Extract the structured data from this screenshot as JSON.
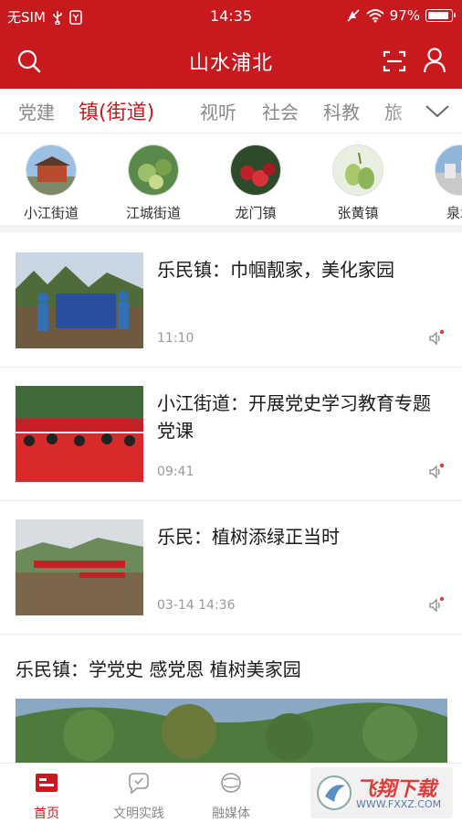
{
  "status_bar": {
    "carrier": "无SIM",
    "time": "14:35",
    "battery": "97%",
    "battery_level": 0.97
  },
  "header": {
    "title": "山水浦北"
  },
  "tabs": [
    {
      "label": "党建"
    },
    {
      "label": "镇(街道)"
    },
    {
      "label": "视听"
    },
    {
      "label": "社会"
    },
    {
      "label": "科教"
    },
    {
      "label": "旅"
    }
  ],
  "streets": [
    {
      "name": "小江街道"
    },
    {
      "name": "江城街道"
    },
    {
      "name": "龙门镇"
    },
    {
      "name": "张黄镇"
    },
    {
      "name": "泉水"
    }
  ],
  "news": [
    {
      "headline": "乐民镇：巾帼靓家，美化家园",
      "time": "11:10"
    },
    {
      "headline": "小江街道：开展党史学习教育专题党课",
      "time": "09:41"
    },
    {
      "headline": "乐民：植树添绿正当时",
      "time": "03-14 14:36"
    }
  ],
  "featured": {
    "headline": "乐民镇：学党史 感党恩 植树美家园"
  },
  "bottom_nav": [
    {
      "label": "首页",
      "icon": "home-icon"
    },
    {
      "label": "文明实践",
      "icon": "practice-icon"
    },
    {
      "label": "融媒体",
      "icon": "media-icon"
    }
  ],
  "watermark": {
    "text": "飞翔下载",
    "url": "WWW.FXXZ.COM"
  },
  "colors": {
    "brand_red": "#c8191e",
    "muted": "#8a8a8a"
  }
}
